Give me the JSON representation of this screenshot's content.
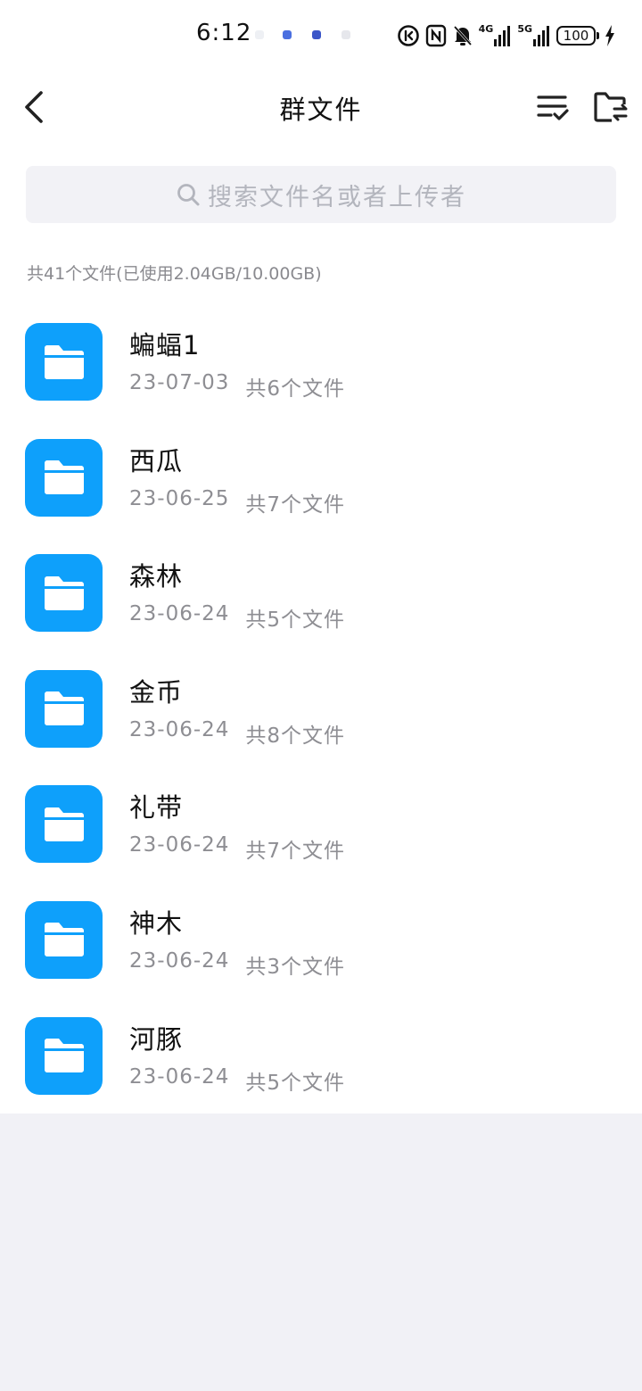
{
  "status_bar": {
    "time": "6:12",
    "battery": "100",
    "signal_1_label": "4G",
    "signal_2_label": "5G"
  },
  "header": {
    "title": "群文件"
  },
  "search": {
    "placeholder": "搜索文件名或者上传者"
  },
  "summary": "共41个文件(已使用2.04GB/10.00GB)",
  "files": [
    {
      "name": "蝙蝠1",
      "date": "23-07-03",
      "count": "共6个文件"
    },
    {
      "name": "西瓜",
      "date": "23-06-25",
      "count": "共7个文件"
    },
    {
      "name": "森林",
      "date": "23-06-24",
      "count": "共5个文件"
    },
    {
      "name": "金币",
      "date": "23-06-24",
      "count": "共8个文件"
    },
    {
      "name": "礼带",
      "date": "23-06-24",
      "count": "共7个文件"
    },
    {
      "name": "神木",
      "date": "23-06-24",
      "count": "共3个文件"
    },
    {
      "name": "河豚",
      "date": "23-06-24",
      "count": "共5个文件"
    }
  ],
  "colors": {
    "folder_blue": "#0ea0fb",
    "background": "#f1f1f6",
    "search_bg": "#f2f2f6"
  },
  "icons": {
    "back": "chevron-left-icon",
    "sort": "list-check-icon",
    "folder_switch": "folder-swap-icon",
    "search": "search-icon",
    "folder": "folder-icon"
  }
}
